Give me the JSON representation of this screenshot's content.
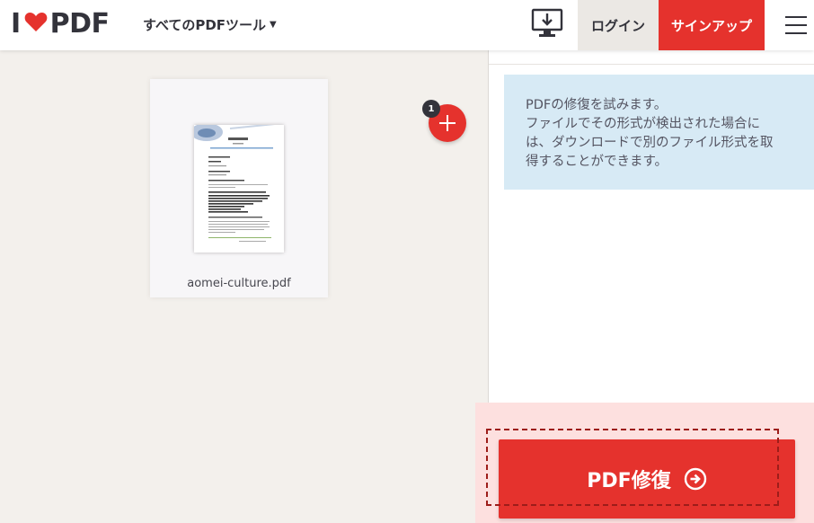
{
  "header": {
    "logo_prefix": "I",
    "logo_suffix": "PDF",
    "tools_menu_label": "すべてのPDFツール",
    "login_label": "ログイン",
    "signup_label": "サインアップ"
  },
  "workspace": {
    "file_name": "aomei-culture.pdf",
    "file_count": "1"
  },
  "sidebar": {
    "info_lines": [
      "PDFの修復を試みます。",
      "ファイルでその形式が検出された場合に",
      "は、ダウンロードで別のファイル形式を取",
      "得することができます。"
    ],
    "process_label": "PDF修復"
  },
  "colors": {
    "brand_red": "#e5322d",
    "info_bg": "#d7eaf5",
    "action_area_bg": "#fde0df",
    "workspace_bg": "#f3f0ec"
  },
  "icons": {
    "heart": "heart-logo-icon",
    "desktop": "desktop-download-icon",
    "menu": "hamburger-menu-icon",
    "add": "plus-icon",
    "arrow": "arrow-right-circle-icon"
  }
}
